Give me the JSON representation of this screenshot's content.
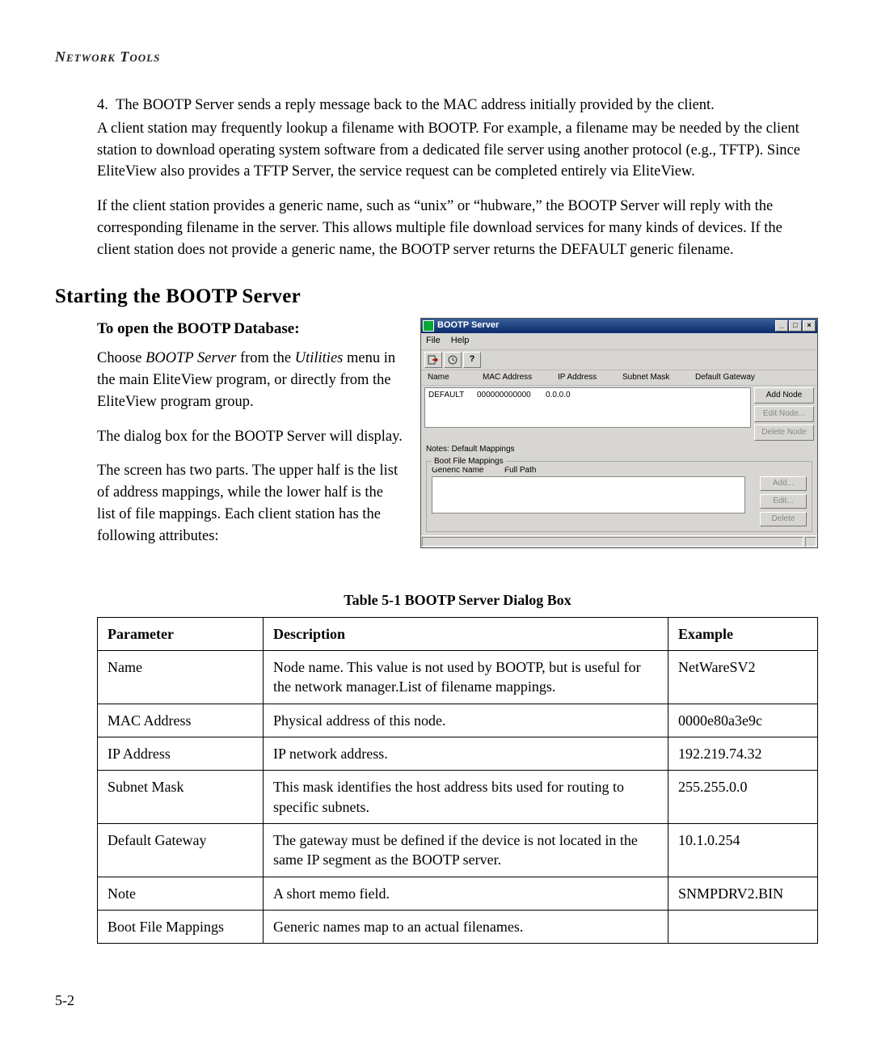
{
  "header": {
    "running": "Network Tools"
  },
  "body": {
    "step4": "The BOOTP Server sends a reply message back to the MAC address initially provided by the client.",
    "p1": "A client station may frequently lookup a filename with BOOTP. For example, a filename may be needed by the client station to download operating system software from a dedicated file server using another protocol (e.g., TFTP). Since EliteView also provides a TFTP Server, the service request can be completed entirely via EliteView.",
    "p2": "If the client station provides a generic name, such as “unix” or “hubware,” the BOOTP Server will reply with the corresponding filename in the server. This allows multiple file download services for many kinds of devices. If the client station does not provide a generic name, the BOOTP server returns the DEFAULT generic filename."
  },
  "section": {
    "title": "Starting the BOOTP Server"
  },
  "left": {
    "h": "To open the BOOTP Database:",
    "p1a": "Choose ",
    "p1b": "BOOTP Server",
    "p1c": " from the ",
    "p1d": "Utilities",
    "p1e": " menu in the main EliteView program, or directly from the EliteView program group.",
    "p2": "The dialog box for the BOOTP Server will display.",
    "p3": "The screen has two parts. The upper half is the list of address mappings, while the lower half is the list of file mappings. Each client station has the following attributes:"
  },
  "dialog": {
    "title": "BOOTP Server",
    "menu": {
      "file": "File",
      "help": "Help"
    },
    "cols": {
      "name": "Name",
      "mac": "MAC Address",
      "ip": "IP Address",
      "subnet": "Subnet Mask",
      "gw": "Default Gateway"
    },
    "row": {
      "name": "DEFAULT",
      "mac": "000000000000",
      "ip": "0.0.0.0",
      "subnet": "",
      "gw": ""
    },
    "btns": {
      "add": "Add Node",
      "edit": "Edit Node...",
      "del": "Delete Node"
    },
    "notes": "Notes: Default Mappings",
    "group": {
      "title": "Boot File Mappings",
      "h1": "Generic Name",
      "h2": "Full Path",
      "add": "Add...",
      "edit": "Edit...",
      "del": "Delete"
    }
  },
  "table": {
    "caption": "Table 5-1  BOOTP Server Dialog Box",
    "h": {
      "param": "Parameter",
      "desc": "Description",
      "ex": "Example"
    },
    "rows": [
      {
        "param": "Name",
        "desc": "Node name. This value is not used by BOOTP, but is useful for the network manager.List of filename mappings.",
        "ex": "NetWareSV2"
      },
      {
        "param": "MAC Address",
        "desc": "Physical address of this node.",
        "ex": "0000e80a3e9c"
      },
      {
        "param": "IP Address",
        "desc": "IP network address.",
        "ex": "192.219.74.32"
      },
      {
        "param": "Subnet Mask",
        "desc": "This mask identifies the host address bits used for routing to specific subnets.",
        "ex": "255.255.0.0"
      },
      {
        "param": "Default Gateway",
        "desc": "The gateway must be defined if the device is not located in the same IP segment as the BOOTP server.",
        "ex": "10.1.0.254"
      },
      {
        "param": "Note",
        "desc": "A short memo field.",
        "ex": "SNMPDRV2.BIN"
      },
      {
        "param": "Boot File Mappings",
        "desc": "Generic names map to an actual filenames.",
        "ex": ""
      }
    ]
  },
  "page": {
    "num": "5-2"
  }
}
